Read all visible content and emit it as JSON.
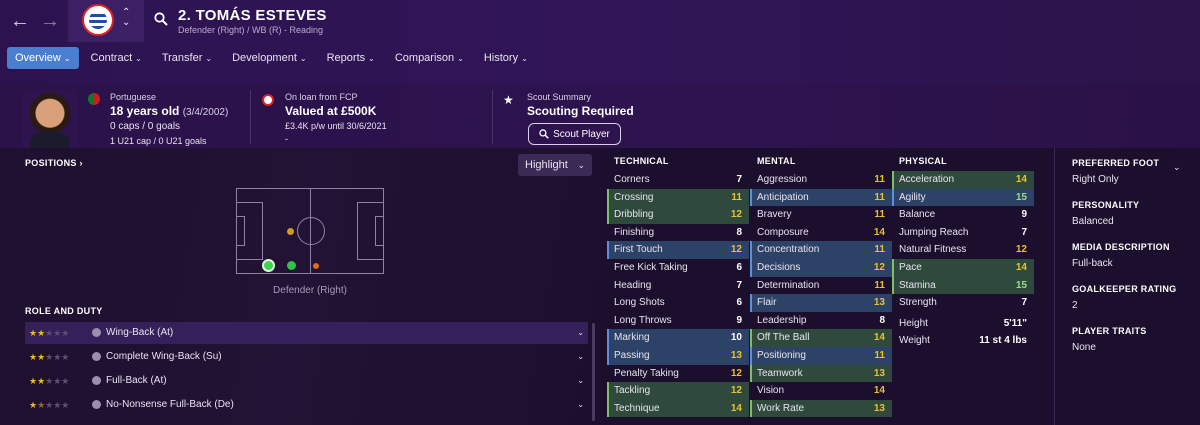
{
  "header": {
    "title": "2. TOMÁS ESTEVES",
    "subtitle": "Defender (Right) / WB (R) - Reading"
  },
  "tabs": [
    {
      "label": "Overview",
      "active": true
    },
    {
      "label": "Contract"
    },
    {
      "label": "Transfer"
    },
    {
      "label": "Development"
    },
    {
      "label": "Reports"
    },
    {
      "label": "Comparison"
    },
    {
      "label": "History"
    }
  ],
  "profile": {
    "nationality": "Portuguese",
    "age": "18 years old",
    "dob": "(3/4/2002)",
    "caps": "0 caps / 0 goals",
    "u21": "1 U21 cap / 0 U21 goals"
  },
  "loan": {
    "heading": "On loan from FCP",
    "value": "Valued at £500K",
    "wage": "£3.4K p/w until 30/6/2021",
    "extra": "-"
  },
  "scout": {
    "heading": "Scout Summary",
    "value": "Scouting Required",
    "button": "Scout Player"
  },
  "positions": {
    "heading": "POSITIONS",
    "highlight": "Highlight",
    "caption": "Defender (Right)"
  },
  "roles": {
    "heading": "ROLE AND DUTY",
    "items": [
      {
        "name": "Wing-Back (At)",
        "stars": 2,
        "selected": true
      },
      {
        "name": "Complete Wing-Back (Su)",
        "stars": 2
      },
      {
        "name": "Full-Back (At)",
        "stars": 2
      },
      {
        "name": "No-Nonsense Full-Back (De)",
        "stars": 1.5
      }
    ]
  },
  "attributes": {
    "technical": {
      "heading": "TECHNICAL",
      "items": [
        {
          "name": "Corners",
          "value": "7"
        },
        {
          "name": "Crossing",
          "value": "11",
          "hl": "g"
        },
        {
          "name": "Dribbling",
          "value": "12",
          "hl": "g"
        },
        {
          "name": "Finishing",
          "value": "8"
        },
        {
          "name": "First Touch",
          "value": "12",
          "hl": "b"
        },
        {
          "name": "Free Kick Taking",
          "value": "6"
        },
        {
          "name": "Heading",
          "value": "7"
        },
        {
          "name": "Long Shots",
          "value": "6"
        },
        {
          "name": "Long Throws",
          "value": "9"
        },
        {
          "name": "Marking",
          "value": "10",
          "hl": "b"
        },
        {
          "name": "Passing",
          "value": "13",
          "hl": "b"
        },
        {
          "name": "Penalty Taking",
          "value": "12"
        },
        {
          "name": "Tackling",
          "value": "12",
          "hl": "g"
        },
        {
          "name": "Technique",
          "value": "14",
          "hl": "g"
        }
      ]
    },
    "mental": {
      "heading": "MENTAL",
      "items": [
        {
          "name": "Aggression",
          "value": "11"
        },
        {
          "name": "Anticipation",
          "value": "11",
          "hl": "b"
        },
        {
          "name": "Bravery",
          "value": "11"
        },
        {
          "name": "Composure",
          "value": "14"
        },
        {
          "name": "Concentration",
          "value": "11",
          "hl": "b"
        },
        {
          "name": "Decisions",
          "value": "12",
          "hl": "b"
        },
        {
          "name": "Determination",
          "value": "11"
        },
        {
          "name": "Flair",
          "value": "13",
          "hl": "b"
        },
        {
          "name": "Leadership",
          "value": "8"
        },
        {
          "name": "Off The Ball",
          "value": "14",
          "hl": "g"
        },
        {
          "name": "Positioning",
          "value": "11",
          "hl": "b"
        },
        {
          "name": "Teamwork",
          "value": "13",
          "hl": "g"
        },
        {
          "name": "Vision",
          "value": "14"
        },
        {
          "name": "Work Rate",
          "value": "13",
          "hl": "g"
        }
      ]
    },
    "physical": {
      "heading": "PHYSICAL",
      "items": [
        {
          "name": "Acceleration",
          "value": "14",
          "hl": "g"
        },
        {
          "name": "Agility",
          "value": "15",
          "hl": "b"
        },
        {
          "name": "Balance",
          "value": "9"
        },
        {
          "name": "Jumping Reach",
          "value": "7"
        },
        {
          "name": "Natural Fitness",
          "value": "12"
        },
        {
          "name": "Pace",
          "value": "14",
          "hl": "g"
        },
        {
          "name": "Stamina",
          "value": "15",
          "hl": "g"
        },
        {
          "name": "Strength",
          "value": "7"
        }
      ],
      "height_label": "Height",
      "height": "5'11\"",
      "weight_label": "Weight",
      "weight": "11 st 4 lbs"
    }
  },
  "info": {
    "preferred_foot_label": "PREFERRED FOOT",
    "preferred_foot": "Right Only",
    "personality_label": "PERSONALITY",
    "personality": "Balanced",
    "media_label": "MEDIA DESCRIPTION",
    "media": "Full-back",
    "gk_label": "GOALKEEPER RATING",
    "gk": "2",
    "traits_label": "PLAYER TRAITS",
    "traits": "None"
  },
  "colors": {
    "accent": "#4a7fcf",
    "star": "#e9b92a",
    "value_high": "#e9c12f",
    "value_top": "#9ed98f"
  }
}
